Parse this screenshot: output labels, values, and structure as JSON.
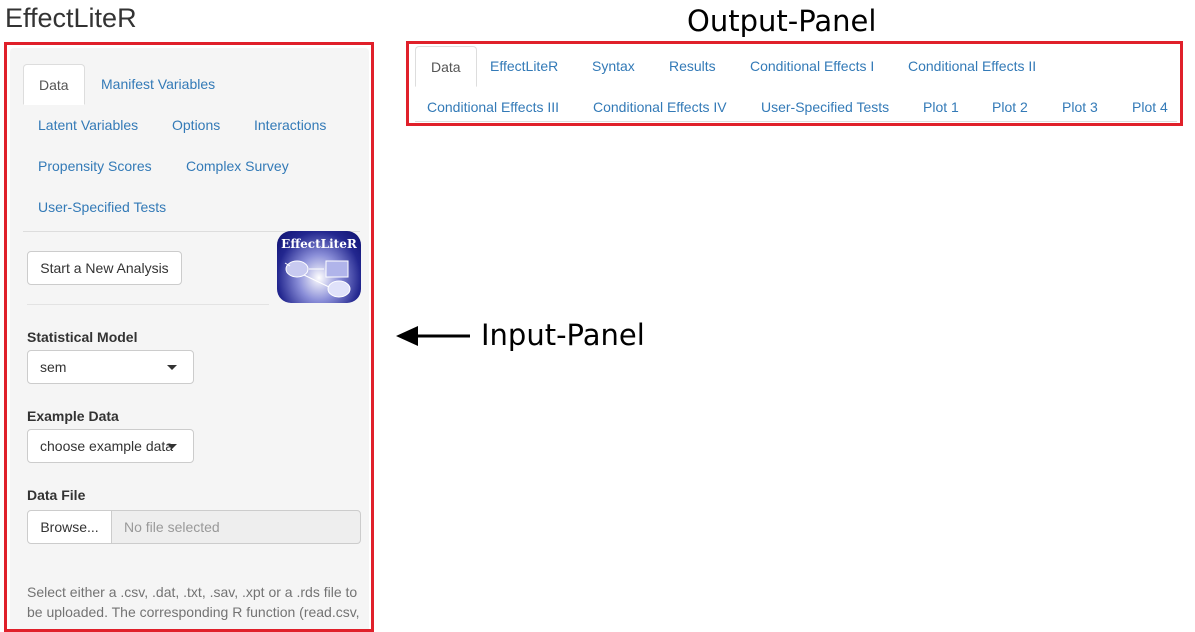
{
  "app": {
    "title": "EffectLiteR"
  },
  "annotations": {
    "output_panel": "Output-Panel",
    "input_panel": "Input-Panel"
  },
  "input_tabs": [
    {
      "label": "Data",
      "active": true
    },
    {
      "label": "Manifest Variables"
    },
    {
      "label": "Latent Variables"
    },
    {
      "label": "Options"
    },
    {
      "label": "Interactions"
    },
    {
      "label": "Propensity Scores"
    },
    {
      "label": "Complex Survey"
    },
    {
      "label": "User-Specified Tests"
    }
  ],
  "start_button": {
    "label": "Start a New Analysis"
  },
  "logo": {
    "text": "EffectLiteR"
  },
  "statistical_model": {
    "label": "Statistical Model",
    "value": "sem"
  },
  "example_data": {
    "label": "Example Data",
    "value": "choose example data"
  },
  "data_file": {
    "label": "Data File",
    "browse_label": "Browse...",
    "placeholder": "No file selected"
  },
  "help_text": "Select either a .csv, .dat, .txt, .sav, .xpt or a .rds file to be uploaded. The corresponding R function (read.csv,",
  "output_tabs": [
    {
      "label": "Data",
      "active": true
    },
    {
      "label": "EffectLiteR"
    },
    {
      "label": "Syntax"
    },
    {
      "label": "Results"
    },
    {
      "label": "Conditional Effects I"
    },
    {
      "label": "Conditional Effects II"
    },
    {
      "label": "Conditional Effects III"
    },
    {
      "label": "Conditional Effects IV"
    },
    {
      "label": "User-Specified Tests"
    },
    {
      "label": "Plot 1"
    },
    {
      "label": "Plot 2"
    },
    {
      "label": "Plot 3"
    },
    {
      "label": "Plot 4"
    }
  ],
  "colors": {
    "annotation_border": "#e0202a",
    "link": "#337ab7",
    "well": "#f5f5f5"
  }
}
